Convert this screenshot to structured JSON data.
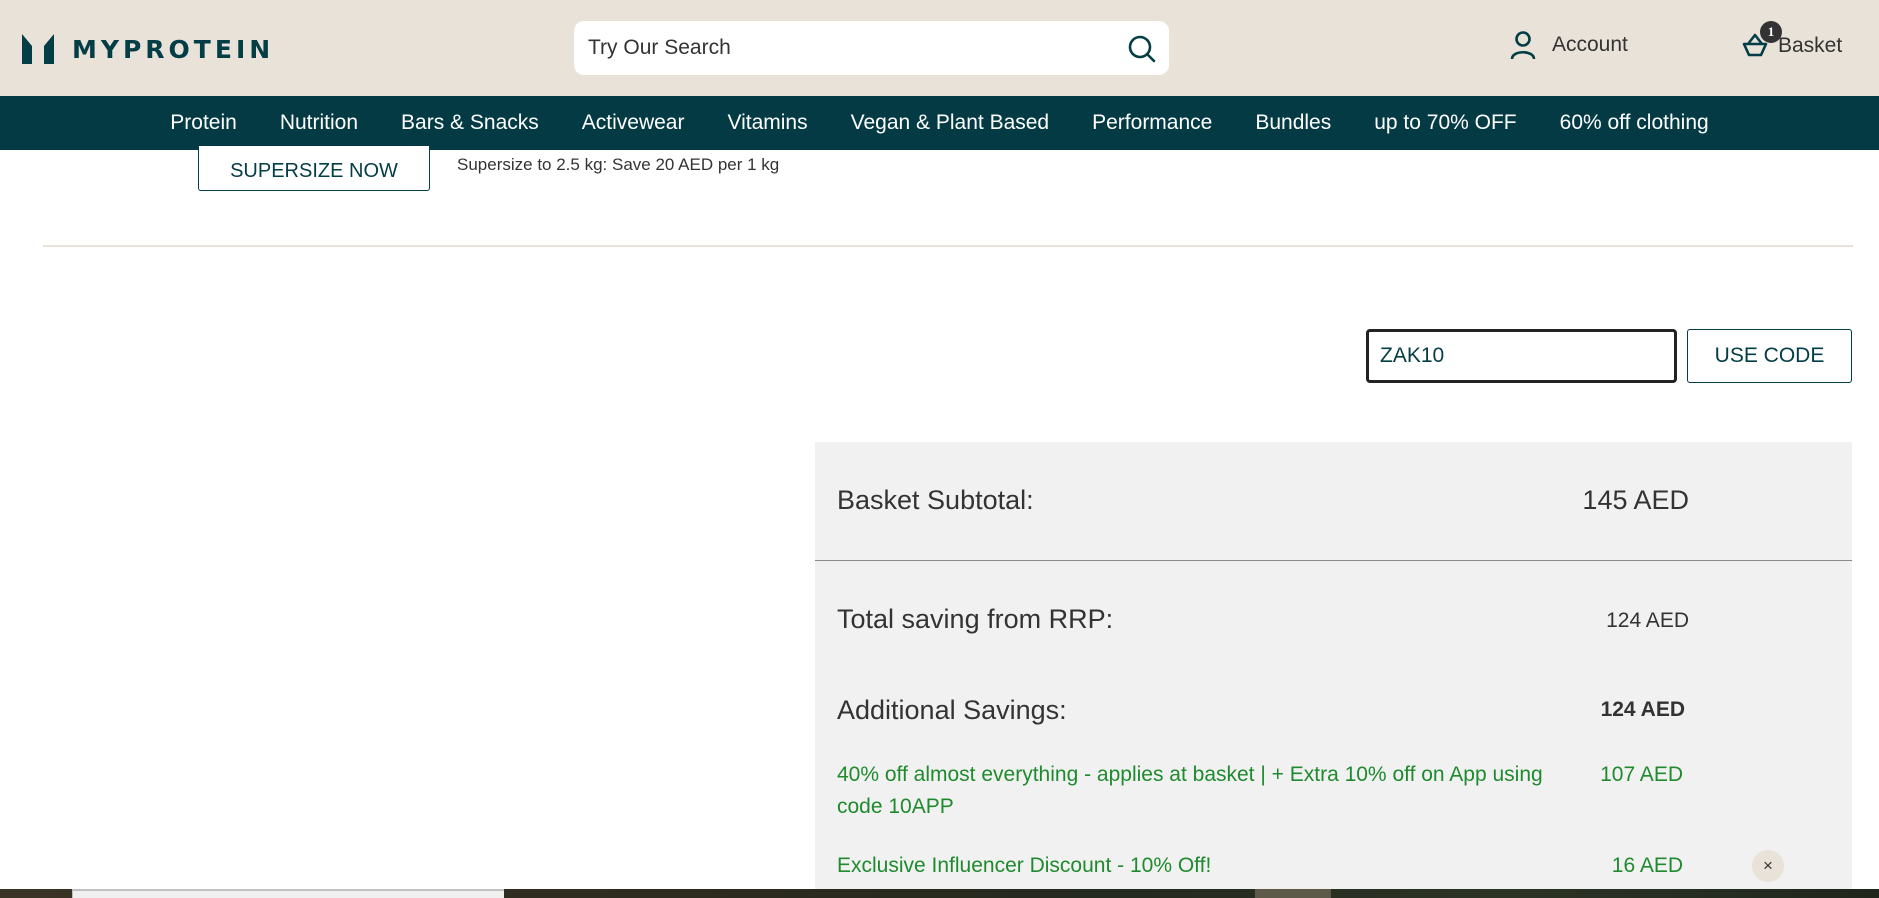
{
  "header": {
    "brand": "MYPROTEIN",
    "logo_icon": "myprotein-m-logo",
    "search": {
      "placeholder": "Try Our Search",
      "value": "",
      "icon": "search-icon"
    },
    "account": {
      "label": "Account",
      "icon": "user-icon"
    },
    "basket": {
      "label": "Basket",
      "icon": "basket-icon",
      "count": "1"
    }
  },
  "nav": {
    "items": [
      {
        "label": "Protein"
      },
      {
        "label": "Nutrition"
      },
      {
        "label": "Bars & Snacks"
      },
      {
        "label": "Activewear"
      },
      {
        "label": "Vitamins"
      },
      {
        "label": "Vegan & Plant Based"
      },
      {
        "label": "Performance"
      },
      {
        "label": "Bundles"
      },
      {
        "label": "up to 70% OFF"
      },
      {
        "label": "60% off clothing"
      }
    ]
  },
  "supersize": {
    "button_label": "SUPERSIZE NOW",
    "description": "Supersize to 2.5 kg: Save 20 AED per 1 kg"
  },
  "discount_code": {
    "value": "ZAK10",
    "placeholder": "",
    "button_label": "USE CODE"
  },
  "summary": {
    "subtotal_label": "Basket Subtotal:",
    "subtotal_value": "145 AED",
    "rrp_saving_label": "Total saving from RRP:",
    "rrp_saving_value": "124 AED",
    "additional_savings_label": "Additional Savings:",
    "additional_savings_value": "124 AED",
    "promotions": [
      {
        "label": "40% off almost everything - applies at basket | + Extra 10% off on App using code 10APP",
        "value": "107 AED",
        "removable": false
      },
      {
        "label": "Exclusive Influencer Discount - 10% Off!",
        "value": "16 AED",
        "removable": true,
        "remove_label": "×"
      }
    ]
  },
  "colors": {
    "header_bg": "#e8e2d9",
    "nav_bg": "#033a44",
    "brand": "#033d45",
    "promo_green": "#1f8a2e",
    "summary_bg": "#f1f1f1"
  }
}
